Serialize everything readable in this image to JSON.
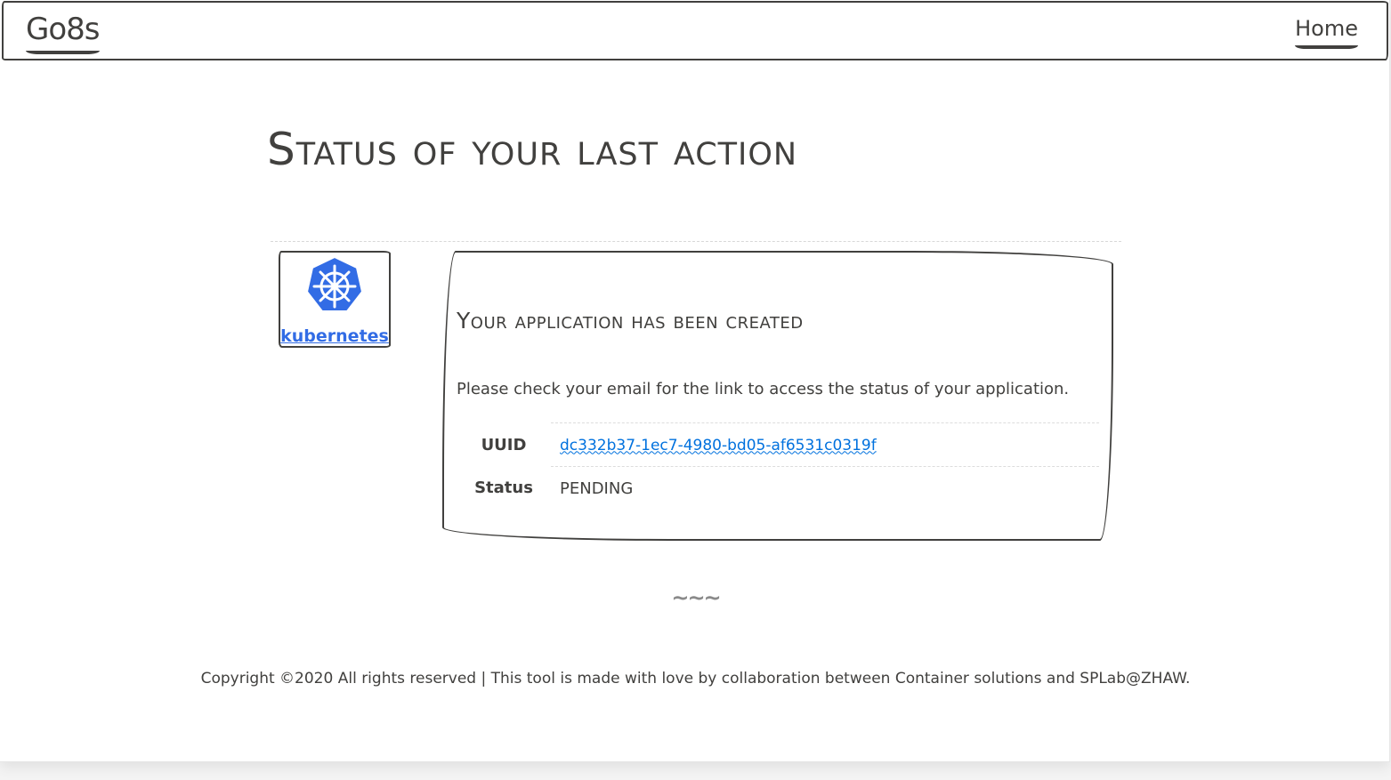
{
  "navbar": {
    "brand": "Go8s",
    "home_label": "Home"
  },
  "main": {
    "title": "Status of your last action",
    "logo_text": "kubernetes",
    "card": {
      "title": "Your application has been created",
      "message": "Please check your email for the link to access the status of your application.",
      "rows": [
        {
          "label": "UUID",
          "value": "dc332b37-1ec7-4980-bd05-af6531c0319f"
        },
        {
          "label": "Status",
          "value": "PENDING"
        }
      ]
    }
  },
  "separator": "~~~",
  "footer": {
    "text": "Copyright ©2020 All rights reserved | This tool is made with love by collaboration between Container solutions and SPLab@ZHAW."
  },
  "colors": {
    "text": "#41403e",
    "link": "#0071de",
    "kubernetes_blue": "#326ce5"
  },
  "icons": {
    "logo": "kubernetes-helm-icon"
  }
}
